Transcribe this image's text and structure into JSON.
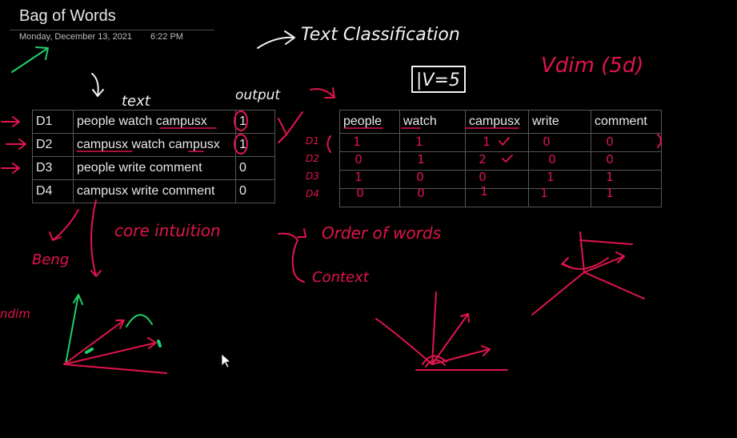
{
  "page": {
    "title": "Bag of Words",
    "date": "Monday, December 13, 2021",
    "time": "6:22 PM"
  },
  "docs_table": {
    "rows": [
      {
        "id": "D1",
        "text": "people watch campusx",
        "output": "1"
      },
      {
        "id": "D2",
        "text": "campusx watch campusx",
        "output": "1"
      },
      {
        "id": "D3",
        "text": "people write comment",
        "output": "0"
      },
      {
        "id": "D4",
        "text": "campusx write comment",
        "output": "0"
      }
    ]
  },
  "bow_table": {
    "headers": [
      "people",
      "watch",
      "campusx",
      "write",
      "comment"
    ]
  },
  "annotations": {
    "text_classification": "Text Classification",
    "v_equals": "|V=5",
    "vdim": "Vdim (5d)",
    "text_label": "text",
    "output_label": "output",
    "row_labels": [
      "D1",
      "D2",
      "D3",
      "D4"
    ],
    "vector_rows": [
      [
        "1",
        "1",
        "1",
        "0",
        "0"
      ],
      [
        "0",
        "1",
        "2",
        "0",
        "0"
      ],
      [
        "1",
        "0",
        "0",
        "1",
        "1"
      ],
      [
        "0",
        "0",
        "1",
        "1",
        "1"
      ]
    ],
    "core_intuition": "core intuition",
    "order_of_words": "Order of words",
    "context": "Context",
    "beng": "Beng",
    "ndim": "ndim"
  },
  "colors": {
    "background": "#000000",
    "ink_red": "#e0144c",
    "ink_white": "#f2f2f2",
    "ink_green": "#1fcf6a",
    "table_border": "#555555"
  }
}
